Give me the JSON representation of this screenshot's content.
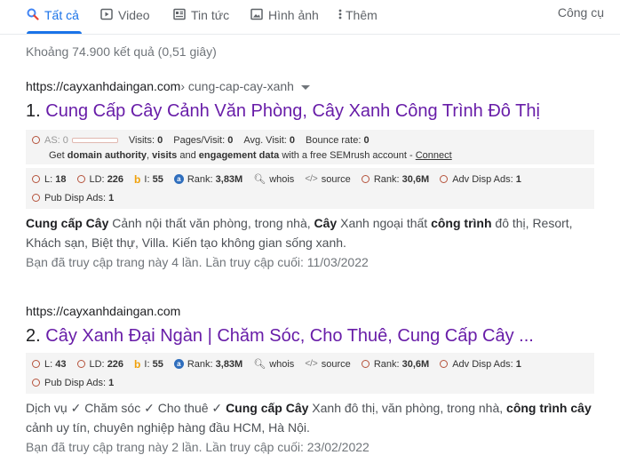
{
  "tabs": [
    {
      "label": "Tất cả",
      "icon": "search-icon"
    },
    {
      "label": "Video",
      "icon": "video-icon"
    },
    {
      "label": "Tin tức",
      "icon": "news-icon"
    },
    {
      "label": "Hình ảnh",
      "icon": "image-icon"
    },
    {
      "label": "Thêm",
      "icon": "more-icon"
    }
  ],
  "tools_label": "Công cụ",
  "stats": "Khoảng 74.900 kết quả (0,51 giây)",
  "results": [
    {
      "domain": "https://cayxanhdaingan.com",
      "path": " › cung-cap-cay-xanh",
      "num": "1. ",
      "title": "Cung Cấp Cây Cảnh Văn Phòng, Cây Xanh Công Trình Đô Thị",
      "traffic": {
        "as": "AS: 0",
        "visits_label": "Visits:",
        "visits": "0",
        "pages_label": "Pages/Visit:",
        "pages": "0",
        "avg_label": "Avg. Visit:",
        "avg": "0",
        "bounce_label": "Bounce rate:",
        "bounce": "0",
        "promo_pre": "Get ",
        "promo_b1": "domain authority",
        "promo_mid1": ", ",
        "promo_b2": "visits",
        "promo_mid2": " and ",
        "promo_b3": "engagement data",
        "promo_post": " with a free SEMrush account - ",
        "connect": "Connect"
      },
      "metrics": {
        "l_label": "L:",
        "l": "18",
        "ld_label": "LD:",
        "ld": "226",
        "i_label": "I:",
        "i": "55",
        "rank_label": "Rank:",
        "rank": "3,83M",
        "whois": "whois",
        "source": "source",
        "rank2_label": "Rank:",
        "rank2": "30,6M",
        "adv_label": "Adv Disp Ads:",
        "adv": "1",
        "pub_label": "Pub Disp Ads:",
        "pub": "1"
      },
      "snippet": [
        {
          "t": "Cung cấp Cây",
          "b": true
        },
        {
          "t": " Cảnh nội thất văn phòng, trong nhà, ",
          "b": false
        },
        {
          "t": "Cây",
          "b": true
        },
        {
          "t": " Xanh ngoại thất ",
          "b": false
        },
        {
          "t": "công trình",
          "b": true
        },
        {
          "t": " đô thị, Resort, Khách sạn, Biệt thự, Villa. Kiến tạo không gian sống xanh.",
          "b": false
        }
      ],
      "visited": "Bạn đã truy cập trang này 4 lần. Lần truy cập cuối: 11/03/2022"
    },
    {
      "domain": "https://cayxanhdaingan.com",
      "num": "2. ",
      "title": "Cây Xanh Đại Ngàn | Chăm Sóc, Cho Thuê, Cung Cấp Cây ...",
      "metrics": {
        "l_label": "L:",
        "l": "43",
        "ld_label": "LD:",
        "ld": "226",
        "i_label": "I:",
        "i": "55",
        "rank_label": "Rank:",
        "rank": "3,83M",
        "whois": "whois",
        "source": "source",
        "rank2_label": "Rank:",
        "rank2": "30,6M",
        "adv_label": "Adv Disp Ads:",
        "adv": "1",
        "pub_label": "Pub Disp Ads:",
        "pub": "1"
      },
      "snippet": [
        {
          "t": "Dịch vụ ✓ Chăm sóc ✓ Cho thuê ✓ ",
          "b": false
        },
        {
          "t": "Cung cấp Cây",
          "b": true
        },
        {
          "t": " Xanh đô thị, văn phòng, trong nhà, ",
          "b": false
        },
        {
          "t": "công trình cây",
          "b": true
        },
        {
          "t": " cảnh uy tín, chuyên nghiệp hàng đầu HCM, Hà Nội.",
          "b": false
        }
      ],
      "visited": "Bạn đã truy cập trang này 2 lần. Lần truy cập cuối: 23/02/2022"
    }
  ]
}
